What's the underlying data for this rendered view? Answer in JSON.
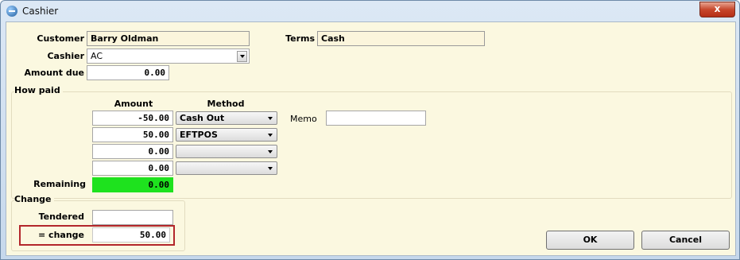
{
  "window": {
    "title": "Cashier",
    "close_label": "x"
  },
  "customer": {
    "label": "Customer",
    "value": "Barry Oldman"
  },
  "terms": {
    "label": "Terms",
    "value": "Cash"
  },
  "cashier": {
    "label": "Cashier",
    "value": "AC"
  },
  "amount_due": {
    "label": "Amount due",
    "value": "0.00"
  },
  "how_paid": {
    "title": "How paid",
    "amount_header": "Amount",
    "method_header": "Method",
    "rows": [
      {
        "amount": "-50.00",
        "method": "Cash Out"
      },
      {
        "amount": "50.00",
        "method": "EFTPOS"
      },
      {
        "amount": "0.00",
        "method": ""
      },
      {
        "amount": "0.00",
        "method": ""
      }
    ],
    "memo_label": "Memo",
    "memo_value": "",
    "remaining_label": "Remaining",
    "remaining_value": "0.00"
  },
  "change": {
    "title": "Change",
    "tendered_label": "Tendered",
    "tendered_value": "",
    "change_label": "= change",
    "change_value": "50.00"
  },
  "buttons": {
    "ok": "OK",
    "cancel": "Cancel"
  },
  "colors": {
    "remaining_bg": "#1ee21e",
    "highlight": "#b3262b",
    "dialog_bg": "#fbf8e0"
  }
}
